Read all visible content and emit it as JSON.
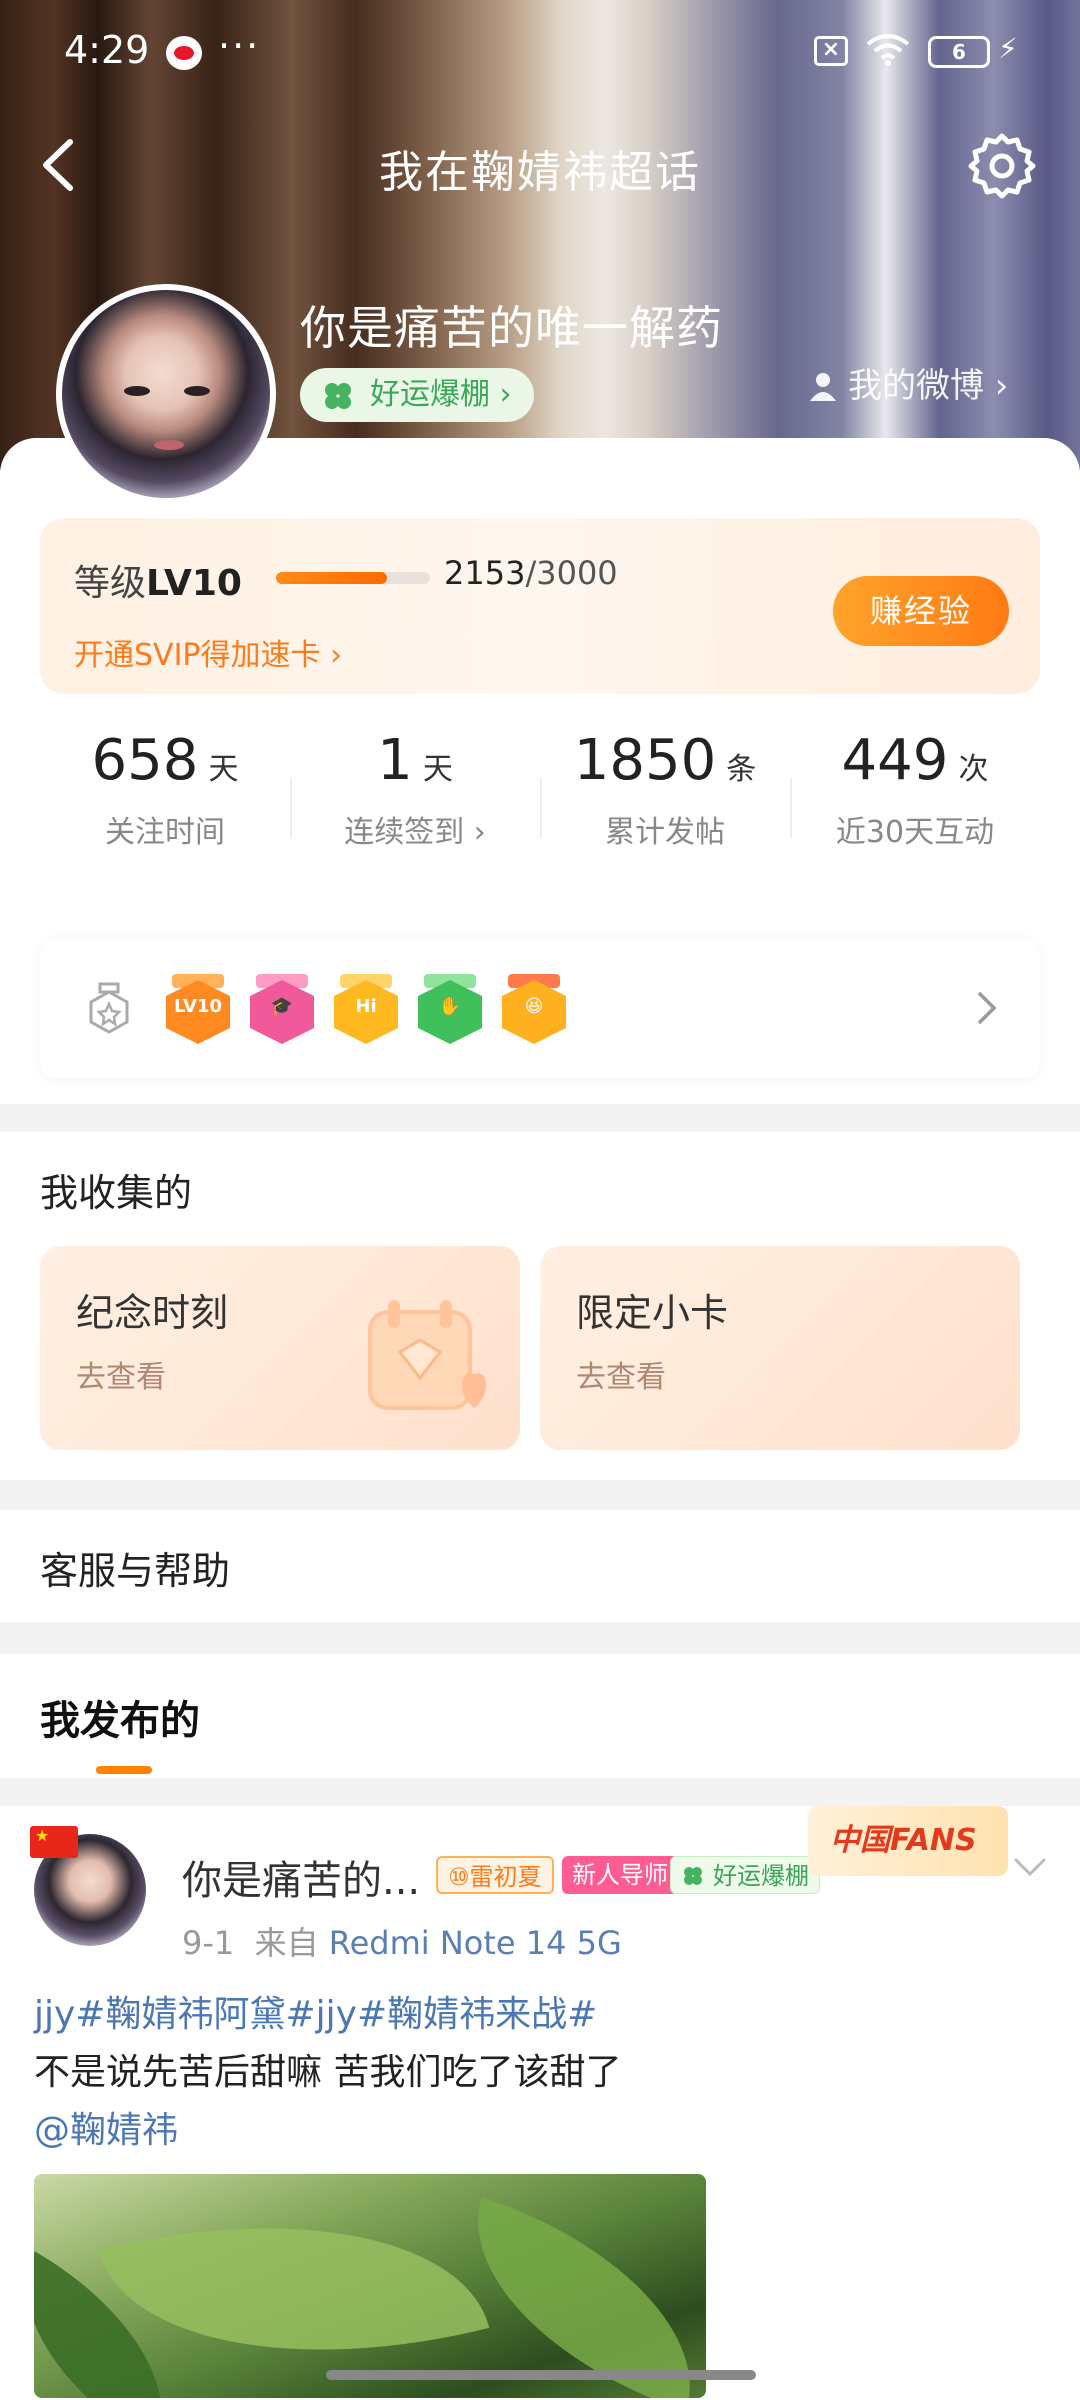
{
  "status": {
    "time": "4:29",
    "dots": "···",
    "battery": "6"
  },
  "header": {
    "title": "我在鞠婧祎超话"
  },
  "profile": {
    "nickname": "你是痛苦的唯一解药",
    "luck_badge": "好运爆棚 ›",
    "my_weibo": "我的微博 ›"
  },
  "level": {
    "label_prefix": "等级",
    "label_value": "LV10",
    "progress_fraction": 0.72,
    "current": "2153",
    "total": "/3000",
    "svip_text": "开通SVIP得加速卡 ›",
    "earn_button": "赚经验"
  },
  "stats": [
    {
      "num": "658",
      "unit": "天",
      "label": "关注时间"
    },
    {
      "num": "1",
      "unit": "天",
      "label": "连续签到 ›"
    },
    {
      "num": "1850",
      "unit": "条",
      "label": "累计发帖"
    },
    {
      "num": "449",
      "unit": "次",
      "label": "近30天互动"
    }
  ],
  "medals": [
    {
      "name": "lv10-medal",
      "text": "LV10",
      "color": "#ff8a22",
      "tab": "#ffb25a"
    },
    {
      "name": "graduation-medal",
      "text": "🎓",
      "color": "#f05a9a",
      "tab": "#ff9cc3"
    },
    {
      "name": "hi-medal",
      "text": "Hi",
      "color": "#ffb81f",
      "tab": "#ffd56a"
    },
    {
      "name": "hand-medal",
      "text": "✋",
      "color": "#3fc05a",
      "tab": "#8fe39c"
    },
    {
      "name": "emoji-medal",
      "text": "😆",
      "color": "#ffb01f",
      "tab": "#ff7a4a"
    }
  ],
  "collect": {
    "title": "我收集的",
    "cards": [
      {
        "title": "纪念时刻",
        "sub": "去查看"
      },
      {
        "title": "限定小卡",
        "sub": "去查看"
      }
    ]
  },
  "help": {
    "title": "客服与帮助"
  },
  "published": {
    "title": "我发布的"
  },
  "post": {
    "name": "你是痛苦的...",
    "level_tag": "⑩雷初夏",
    "mentor_tag": "新人导师",
    "luck_tag": "好运爆棚",
    "fans_badge": "中国FANS",
    "date": "9-1",
    "from_label": "来自",
    "device": "Redmi Note 14 5G",
    "line1": "jjy#鞠婧祎阿黛#jjy#鞠婧祎来战#",
    "line2": "不是说先苦后甜嘛 苦我们吃了该甜了",
    "mention": "@鞠婧祎"
  },
  "colors": {
    "accent": "#ff8200",
    "link": "#4b77b4",
    "svip": "#ff7a1a"
  }
}
